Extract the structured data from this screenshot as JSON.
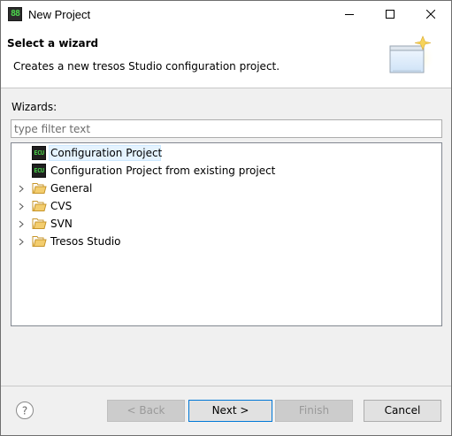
{
  "window": {
    "title": "New Project"
  },
  "banner": {
    "title": "Select a wizard",
    "description": "Creates a new tresos Studio configuration project."
  },
  "wizards": {
    "label": "Wizards:",
    "filter_placeholder": "type filter text",
    "filter_value": "",
    "items": [
      {
        "label": "Configuration Project",
        "icon": "ecu-project-icon",
        "selected": true,
        "expandable": false
      },
      {
        "label": "Configuration Project from existing project",
        "icon": "ecu-project-icon",
        "selected": false,
        "expandable": false
      },
      {
        "label": "General",
        "icon": "folder-icon",
        "selected": false,
        "expandable": true
      },
      {
        "label": "CVS",
        "icon": "folder-icon",
        "selected": false,
        "expandable": true
      },
      {
        "label": "SVN",
        "icon": "folder-icon",
        "selected": false,
        "expandable": true
      },
      {
        "label": "Tresos Studio",
        "icon": "folder-icon",
        "selected": false,
        "expandable": true
      }
    ]
  },
  "buttons": {
    "back": "< Back",
    "next": "Next >",
    "finish": "Finish",
    "cancel": "Cancel"
  },
  "colors": {
    "selection": "#e5f3ff",
    "default_button_border": "#0078d7",
    "folder": "#e8b84a"
  }
}
